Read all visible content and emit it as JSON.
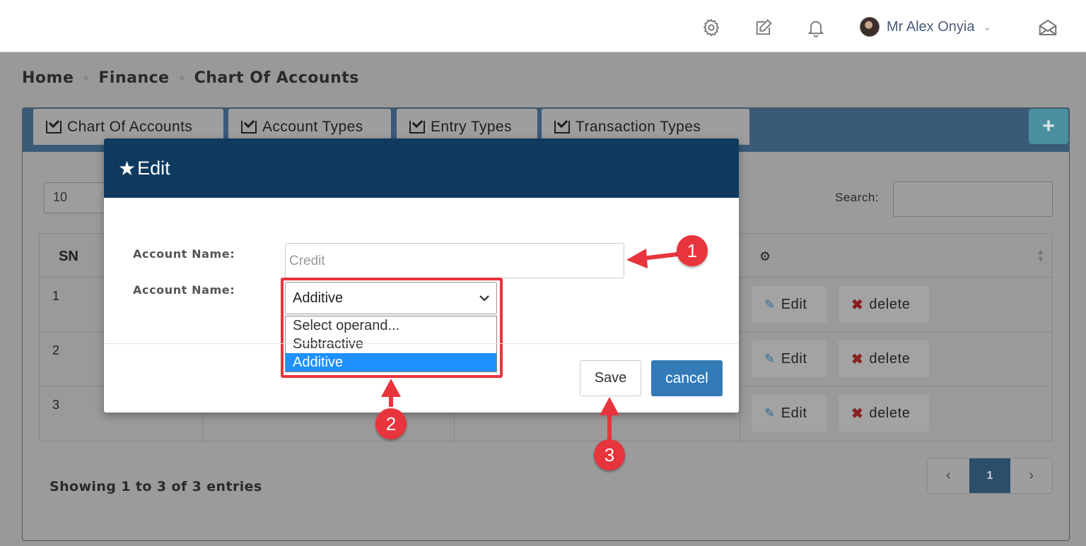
{
  "header": {
    "user_name": "Mr Alex Onyia",
    "icons": [
      "gear-icon",
      "edit-icon",
      "bell-icon",
      "mail-icon"
    ]
  },
  "breadcrumb": [
    "Home",
    "Finance",
    "Chart Of Accounts"
  ],
  "tabs": [
    {
      "label": "Chart Of Accounts"
    },
    {
      "label": "Account Types"
    },
    {
      "label": "Entry Types"
    },
    {
      "label": "Transaction Types"
    }
  ],
  "add_button": "+",
  "table": {
    "length_value": "10",
    "search_label": "Search:",
    "header_sn": "SN",
    "rows": [
      {
        "sn": "1",
        "edit": "Edit",
        "delete": "delete"
      },
      {
        "sn": "2",
        "edit": "Edit",
        "delete": "delete"
      },
      {
        "sn": "3",
        "edit": "Edit",
        "delete": "delete"
      }
    ],
    "info": "Showing 1 to 3 of 3 entries",
    "pager": {
      "prev": "‹",
      "page": "1",
      "next": "›"
    }
  },
  "modal": {
    "title": "Edit",
    "field1_label": "Account Name:",
    "field1_value": "Credit",
    "field2_label": "Account Name:",
    "field2_value": "Additive",
    "options": [
      "Select operand...",
      "Subtractive",
      "Additive"
    ],
    "selected_option": "Additive",
    "save_label": "Save",
    "cancel_label": "cancel"
  },
  "annotations": [
    "1",
    "2",
    "3"
  ],
  "colors": {
    "modal_header": "#0f3a5e",
    "annotation_red": "#e8343c",
    "cancel_blue": "#337ab7",
    "option_highlight": "#1e90ff"
  }
}
